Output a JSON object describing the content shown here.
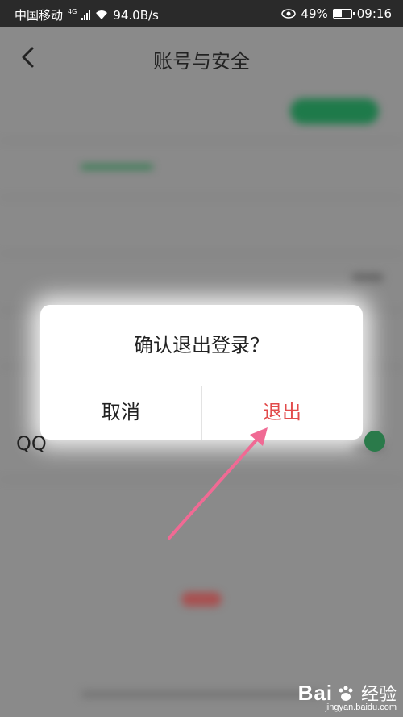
{
  "status_bar": {
    "carrier": "中国移动",
    "network_badge": "4G",
    "speed": "94.0B/s",
    "battery_percent": "49%",
    "battery_level": 0.49,
    "time": "09:16",
    "icons": [
      "signal-icon",
      "wifi-icon",
      "eye-icon",
      "battery-icon"
    ]
  },
  "header": {
    "title": "账号与安全",
    "back_icon": "chevron-left-icon"
  },
  "background": {
    "qq_label": "QQ"
  },
  "dialog": {
    "message": "确认退出登录？",
    "cancel_label": "取消",
    "confirm_label": "退出",
    "confirm_color": "#e24b4b"
  },
  "annotation": {
    "arrow_color": "#f06a94"
  },
  "watermark": {
    "brand": "Bai",
    "brand_suffix": "经验",
    "url": "jingyan.baidu.com"
  }
}
